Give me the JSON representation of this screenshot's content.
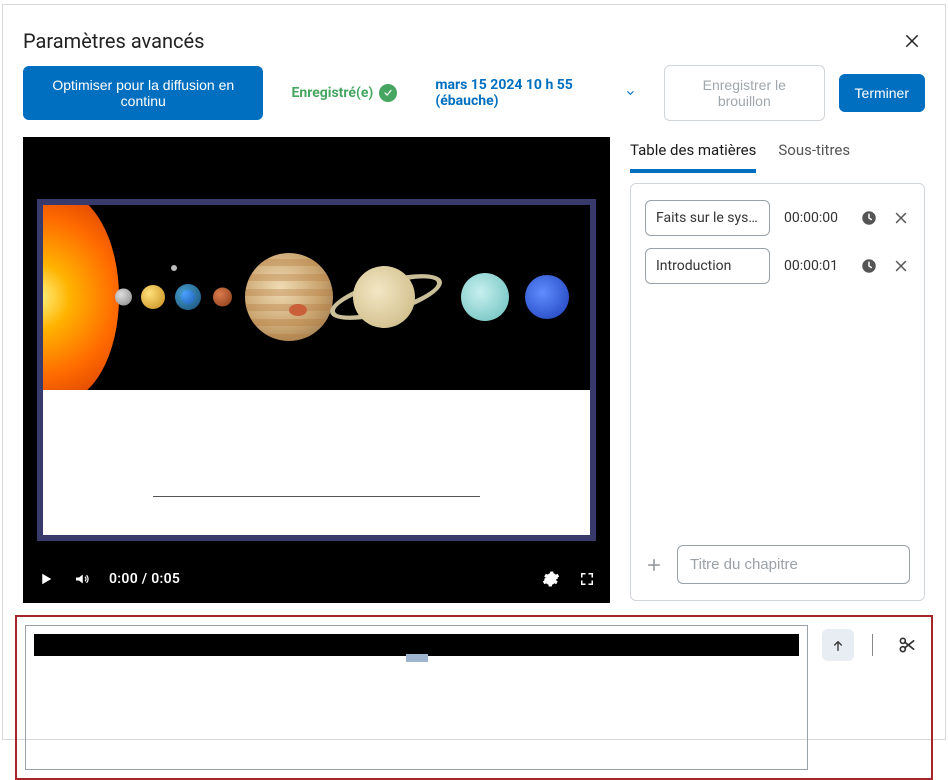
{
  "header": {
    "title": "Paramètres avancés"
  },
  "toolbar": {
    "optimize_label": "Optimiser pour la diffusion en continu",
    "status_text": "Enregistré(e)",
    "draft_link": "mars 15 2024 10 h 55 (ébauche)",
    "save_draft_label": "Enregistrer le brouillon",
    "finish_label": "Terminer"
  },
  "player": {
    "time_display": "0:00 / 0:05"
  },
  "tabs": {
    "toc": "Table des matières",
    "captions": "Sous-titres"
  },
  "toc": {
    "entries": [
      {
        "title": "Faits sur le syst...",
        "time": "00:00:00"
      },
      {
        "title": "Introduction",
        "time": "00:00:01"
      }
    ],
    "add_placeholder": "Titre du chapitre"
  }
}
